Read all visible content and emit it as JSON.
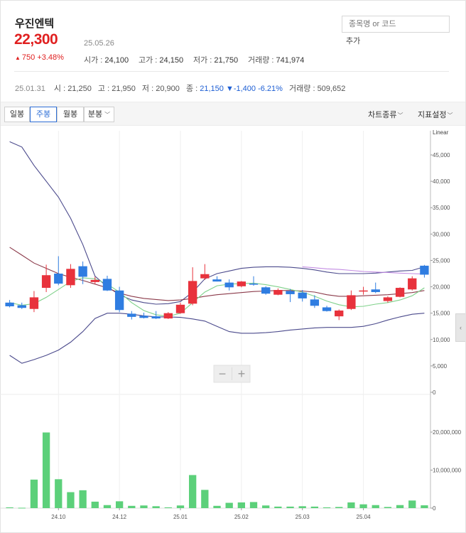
{
  "stock": {
    "name": "우진엔텍",
    "price": "22,300",
    "date": "25.05.26",
    "change_arrow": "▲",
    "change": "750 +3.48%",
    "open_label": "시가",
    "open": "24,100",
    "high_label": "고가",
    "high": "24,150",
    "low_label": "저가",
    "low": "21,750",
    "volume_label": "거래량",
    "volume": "741,974"
  },
  "search": {
    "placeholder": "종목명 or 코드",
    "add_label": "추가"
  },
  "previous": {
    "date": "25.01.31",
    "open_label": "시",
    "open": "21,250",
    "high_label": "고",
    "high": "21,950",
    "low_label": "저",
    "low": "20,900",
    "close_label": "종",
    "close": "21,150",
    "change_arrow": "▼",
    "change": "-1,400 -6.21%",
    "volume_label": "거래량",
    "volume": "509,652"
  },
  "toolbar": {
    "periods": [
      "일봉",
      "주봉",
      "월봉",
      "분봉"
    ],
    "active_period": "주봉",
    "chart_type": "차트종류",
    "indicator": "지표설정"
  },
  "zoom": {
    "minus": "−",
    "plus": "+"
  },
  "side_tab": "‹",
  "colors": {
    "up": "#e8323c",
    "down": "#2f7de1",
    "volume": "#5cd07a",
    "price_text": "#e02020",
    "accent": "#2f6fd6"
  },
  "chart_data": {
    "type": "candlestick",
    "scale_label": "Linear",
    "x_tick_labels": [
      "24.10",
      "24.12",
      "25.01",
      "25.02",
      "25.03",
      "25.04"
    ],
    "x_tick_index": [
      4.5,
      9.5,
      14.5,
      19.5,
      24.5,
      29.5
    ],
    "price_axis": {
      "min": 0,
      "max": 45000,
      "ticks": [
        0,
        5000,
        10000,
        15000,
        20000,
        25000,
        30000,
        35000,
        40000,
        45000
      ]
    },
    "volume_axis": {
      "min": 0,
      "max": 20000000,
      "ticks": [
        0,
        10000000,
        20000000
      ]
    },
    "candles": [
      {
        "o": 17000,
        "h": 17500,
        "l": 16100,
        "c": 16300
      },
      {
        "o": 16500,
        "h": 17000,
        "l": 15800,
        "c": 16000
      },
      {
        "o": 15800,
        "h": 19200,
        "l": 15200,
        "c": 18000
      },
      {
        "o": 19800,
        "h": 24200,
        "l": 19000,
        "c": 22200
      },
      {
        "o": 22500,
        "h": 25800,
        "l": 20300,
        "c": 20600
      },
      {
        "o": 20300,
        "h": 24300,
        "l": 19800,
        "c": 23400
      },
      {
        "o": 23900,
        "h": 24800,
        "l": 20500,
        "c": 21900
      },
      {
        "o": 20900,
        "h": 21900,
        "l": 20500,
        "c": 21300
      },
      {
        "o": 21500,
        "h": 22100,
        "l": 19200,
        "c": 19300
      },
      {
        "o": 19300,
        "h": 20000,
        "l": 15200,
        "c": 15600
      },
      {
        "o": 14900,
        "h": 15400,
        "l": 13800,
        "c": 14300
      },
      {
        "o": 14500,
        "h": 15100,
        "l": 14000,
        "c": 14100
      },
      {
        "o": 14400,
        "h": 15400,
        "l": 13900,
        "c": 14000
      },
      {
        "o": 14000,
        "h": 15200,
        "l": 13900,
        "c": 15000
      },
      {
        "o": 15000,
        "h": 17000,
        "l": 14900,
        "c": 16600
      },
      {
        "o": 16800,
        "h": 23700,
        "l": 16500,
        "c": 21100
      },
      {
        "o": 21600,
        "h": 24300,
        "l": 21300,
        "c": 22400
      },
      {
        "o": 21400,
        "h": 22000,
        "l": 21000,
        "c": 21000
      },
      {
        "o": 20800,
        "h": 21400,
        "l": 19300,
        "c": 19900
      },
      {
        "o": 20100,
        "h": 21100,
        "l": 19900,
        "c": 21000
      },
      {
        "o": 20600,
        "h": 22000,
        "l": 20200,
        "c": 20400
      },
      {
        "o": 19900,
        "h": 20100,
        "l": 18500,
        "c": 18700
      },
      {
        "o": 18500,
        "h": 19700,
        "l": 18400,
        "c": 19400
      },
      {
        "o": 19200,
        "h": 19600,
        "l": 17100,
        "c": 18600
      },
      {
        "o": 18900,
        "h": 19400,
        "l": 17200,
        "c": 17800
      },
      {
        "o": 17600,
        "h": 18400,
        "l": 16000,
        "c": 16400
      },
      {
        "o": 16100,
        "h": 16400,
        "l": 15300,
        "c": 15400
      },
      {
        "o": 14400,
        "h": 15700,
        "l": 13700,
        "c": 15500
      },
      {
        "o": 15800,
        "h": 19300,
        "l": 15600,
        "c": 18400
      },
      {
        "o": 19100,
        "h": 20000,
        "l": 18500,
        "c": 19300
      },
      {
        "o": 19500,
        "h": 20800,
        "l": 18800,
        "c": 19000
      },
      {
        "o": 17300,
        "h": 18200,
        "l": 17000,
        "c": 18000
      },
      {
        "o": 18100,
        "h": 19900,
        "l": 18000,
        "c": 19800
      },
      {
        "o": 19500,
        "h": 22000,
        "l": 19300,
        "c": 21600
      },
      {
        "o": 24000,
        "h": 24150,
        "l": 21750,
        "c": 22300
      }
    ],
    "volumes": [
      200000,
      100000,
      7500000,
      19900000,
      7600000,
      4200000,
      4700000,
      1700000,
      800000,
      1800000,
      600000,
      700000,
      500000,
      200000,
      700000,
      8700000,
      4800000,
      600000,
      1400000,
      1500000,
      1600000,
      700000,
      400000,
      400000,
      500000,
      400000,
      200000,
      300000,
      1500000,
      1000000,
      800000,
      300000,
      800000,
      2000000,
      741974
    ],
    "bollinger_upper": [
      47500,
      46500,
      43000,
      40000,
      37000,
      33000,
      28000,
      22000,
      20000,
      18500,
      17500,
      17000,
      16700,
      16800,
      17200,
      19000,
      21500,
      22500,
      23000,
      23500,
      23700,
      23800,
      23800,
      23700,
      23500,
      23200,
      22800,
      22500,
      22500,
      22500,
      22600,
      22800,
      23000,
      23100,
      23800
    ],
    "bollinger_lower": [
      7000,
      5500,
      6200,
      7000,
      8000,
      9500,
      11500,
      14000,
      15000,
      15000,
      14800,
      14500,
      14300,
      14300,
      14200,
      13900,
      13500,
      12500,
      11500,
      11200,
      11200,
      11300,
      11500,
      11800,
      12000,
      12200,
      12300,
      12300,
      12300,
      12500,
      13000,
      13700,
      14300,
      14800,
      15000
    ],
    "ma_long": [
      27500,
      26000,
      24500,
      23500,
      22500,
      21800,
      21200,
      20500,
      19800,
      18800,
      18200,
      17800,
      17600,
      17400,
      17500,
      17800,
      18200,
      18500,
      18700,
      18900,
      19100,
      19200,
      19300,
      19300,
      19200,
      19000,
      18500,
      18200,
      18200,
      18300,
      18400,
      18500,
      18700,
      18900,
      19300
    ],
    "ma_short": [
      17000,
      16500,
      16800,
      18000,
      19500,
      21000,
      21700,
      21500,
      20500,
      19000,
      17000,
      15500,
      14700,
      14400,
      15000,
      17000,
      19000,
      20200,
      20500,
      20600,
      20700,
      20400,
      20000,
      19500,
      19000,
      18200,
      17300,
      16600,
      16200,
      16300,
      16700,
      17000,
      17500,
      18300,
      19800
    ],
    "ma_purple": [
      null,
      null,
      null,
      null,
      null,
      null,
      null,
      null,
      null,
      null,
      null,
      null,
      null,
      null,
      null,
      null,
      null,
      null,
      null,
      null,
      null,
      null,
      null,
      null,
      23800,
      23600,
      23400,
      23300,
      23100,
      22900,
      22800,
      22700,
      22600,
      22500,
      22400
    ]
  }
}
